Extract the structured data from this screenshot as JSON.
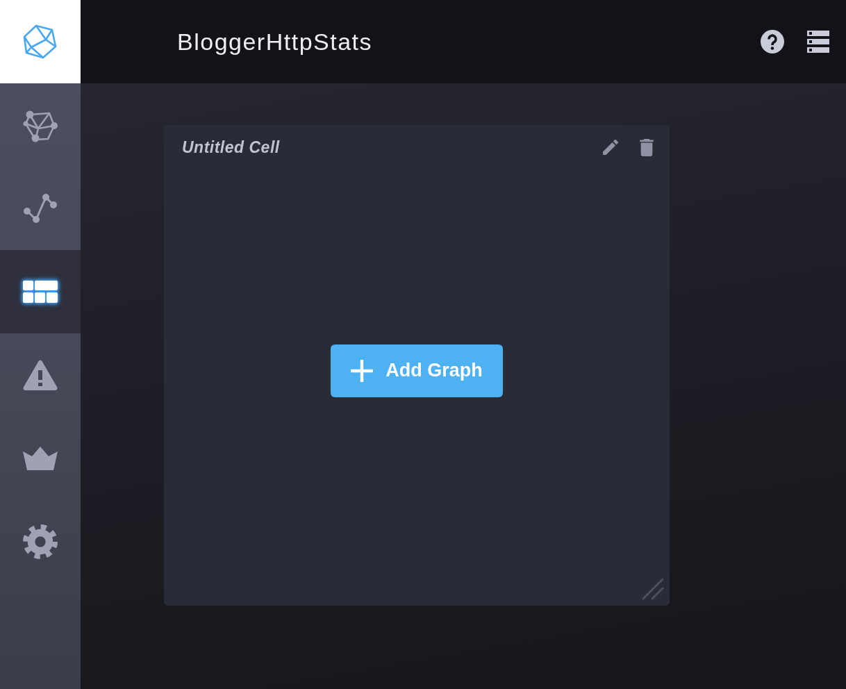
{
  "header": {
    "title": "BloggerHttpStats"
  },
  "sidebar": {
    "items": [
      {
        "kind": "explorer",
        "selected": false
      },
      {
        "kind": "graph",
        "selected": false
      },
      {
        "kind": "dashboards",
        "selected": true
      },
      {
        "kind": "alerts",
        "selected": false
      },
      {
        "kind": "admin",
        "selected": false
      },
      {
        "kind": "settings",
        "selected": false
      }
    ]
  },
  "cell": {
    "title": "Untitled Cell",
    "add_button": {
      "label": "Add Graph"
    }
  }
}
